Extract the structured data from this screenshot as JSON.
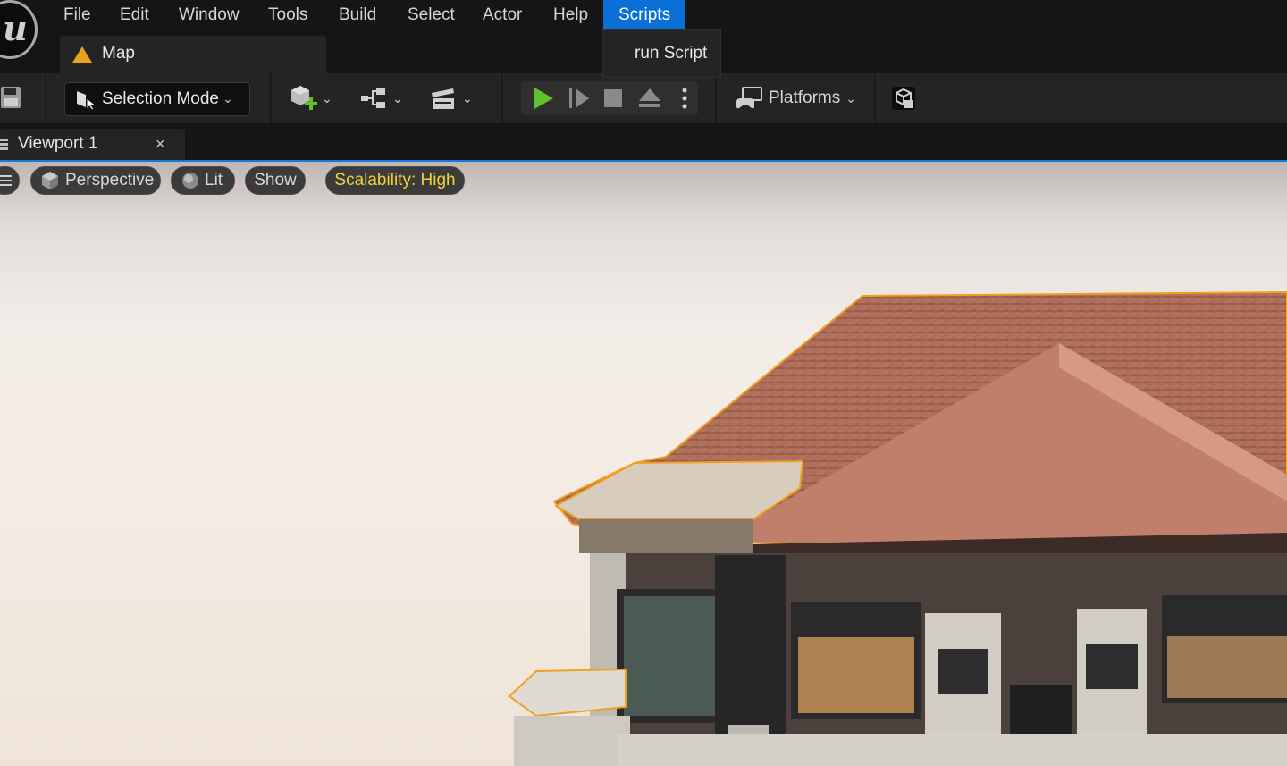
{
  "menubar": {
    "items": [
      "File",
      "Edit",
      "Window",
      "Tools",
      "Build",
      "Select",
      "Actor",
      "Help",
      "Scripts"
    ],
    "active": "Scripts"
  },
  "scripts_menu": {
    "items": [
      "run Script"
    ]
  },
  "level_tab": {
    "label": "Map",
    "icon": "level-map-icon"
  },
  "toolbar": {
    "selection_mode_label": "Selection Mode",
    "platforms_label": "Platforms",
    "icons": [
      "save-icon",
      "select-arrow-icon",
      "add-actor-icon",
      "blueprint-icon",
      "cinematics-icon",
      "play-icon",
      "step-icon",
      "stop-icon",
      "eject-icon",
      "kebab-icon",
      "platforms-icon",
      "settings-cube-icon"
    ]
  },
  "viewport_tab": {
    "label": "Viewport 1",
    "close_glyph": "×"
  },
  "viewport": {
    "view_mode": "Perspective",
    "lighting": "Lit",
    "show_label": "Show",
    "scalability_label": "Scalability: High"
  },
  "colors": {
    "accent_blue": "#0a70d8",
    "play_green": "#5ec22c",
    "scalability_yellow": "#f1d03b",
    "selection_outline": "#f0a020"
  }
}
